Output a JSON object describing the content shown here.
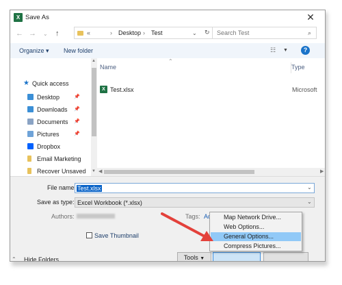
{
  "title": "Save As",
  "address": {
    "overflow": "«",
    "crumbs": [
      "Desktop",
      "Test"
    ]
  },
  "search_placeholder": "Search Test",
  "toolbar": {
    "organize": "Organize ▾",
    "new_folder": "New folder",
    "help": "?"
  },
  "nav_items": [
    {
      "label": "Quick access",
      "icon": "star-icon",
      "color": "#1a73c9"
    },
    {
      "label": "Desktop",
      "icon": "desktop-folder-icon",
      "color": "#3b8fd6",
      "pinned": true
    },
    {
      "label": "Downloads",
      "icon": "downloads-folder-icon",
      "color": "#3b8fd6",
      "pinned": true
    },
    {
      "label": "Documents",
      "icon": "documents-folder-icon",
      "color": "#8aa3c4",
      "pinned": true
    },
    {
      "label": "Pictures",
      "icon": "pictures-folder-icon",
      "color": "#6fa3d8",
      "pinned": true
    },
    {
      "label": "Dropbox",
      "icon": "dropbox-icon",
      "color": "#0061fe"
    },
    {
      "label": "Email Marketing",
      "icon": "folder-icon",
      "color": "#e8c25c"
    },
    {
      "label": "Recover Unsaved",
      "icon": "folder-icon",
      "color": "#e8c25c"
    }
  ],
  "columns": {
    "name": "Name",
    "type": "Type"
  },
  "files": [
    {
      "name": "Test.xlsx",
      "type": "Microsoft"
    }
  ],
  "form": {
    "file_name_label": "File name:",
    "file_name_value": "Test.xlsx",
    "save_type_label": "Save as type:",
    "save_type_value": "Excel Workbook (*.xlsx)",
    "authors_label": "Authors:",
    "tags_label": "Tags:",
    "tags_link": "Add a tag",
    "save_thumbnail": "Save Thumbnail"
  },
  "hide_folders": "Hide Folders",
  "tools_label": "Tools",
  "tools_menu": [
    "Map Network Drive...",
    "Web Options...",
    "General Options...",
    "Compress Pictures..."
  ],
  "highlighted_item": "General Options...",
  "colors": {
    "accent": "#1a73c9",
    "highlight": "#91c9f7",
    "arrow": "#e3413b",
    "excel": "#1f7244"
  }
}
